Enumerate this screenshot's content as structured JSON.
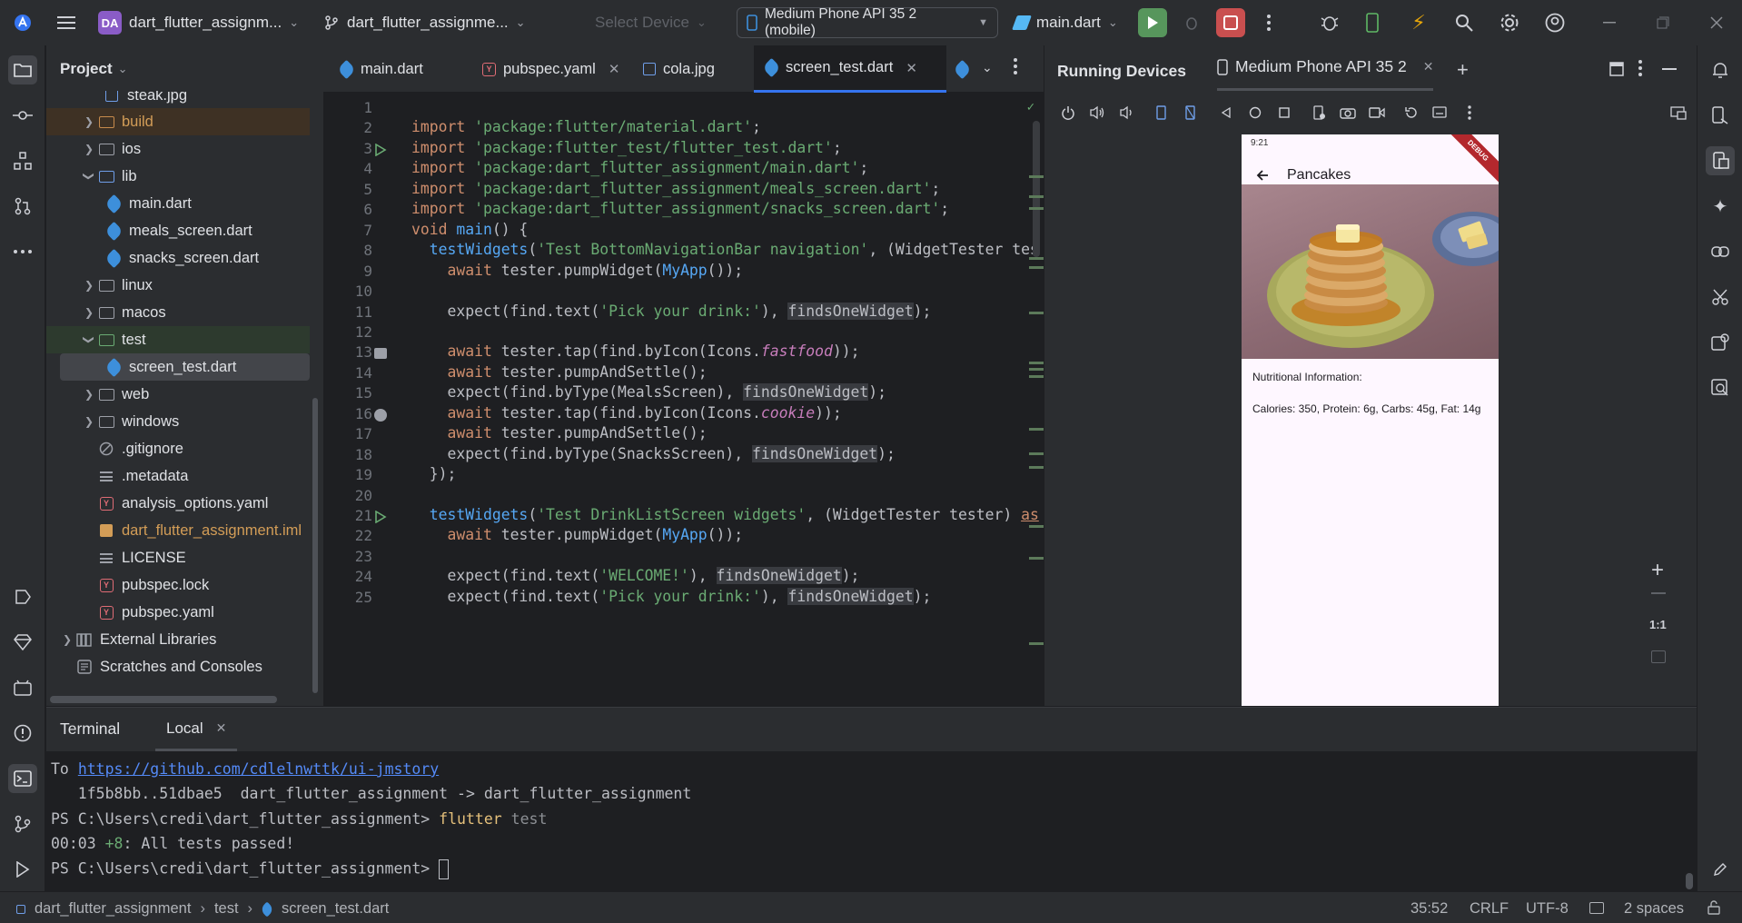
{
  "titlebar": {
    "project_badge": "DA",
    "project_name": "dart_flutter_assignm...",
    "branch": "dart_flutter_assignme...",
    "device_select": "Select Device",
    "running_device": "Medium Phone API 35 2 (mobile)",
    "run_config": "main.dart"
  },
  "project_panel": {
    "title": "Project",
    "items": [
      {
        "label": "steak.jpg",
        "type": "file"
      },
      {
        "label": "build",
        "type": "folder"
      },
      {
        "label": "ios",
        "type": "folder"
      },
      {
        "label": "lib",
        "type": "folder"
      },
      {
        "label": "main.dart",
        "type": "dart"
      },
      {
        "label": "meals_screen.dart",
        "type": "dart"
      },
      {
        "label": "snacks_screen.dart",
        "type": "dart"
      },
      {
        "label": "linux",
        "type": "folder"
      },
      {
        "label": "macos",
        "type": "folder"
      },
      {
        "label": "test",
        "type": "folder"
      },
      {
        "label": "screen_test.dart",
        "type": "dart"
      },
      {
        "label": "web",
        "type": "folder"
      },
      {
        "label": "windows",
        "type": "folder"
      },
      {
        "label": ".gitignore",
        "type": "file"
      },
      {
        "label": ".metadata",
        "type": "file"
      },
      {
        "label": "analysis_options.yaml",
        "type": "yaml"
      },
      {
        "label": "dart_flutter_assignment.iml",
        "type": "file"
      },
      {
        "label": "LICENSE",
        "type": "file"
      },
      {
        "label": "pubspec.lock",
        "type": "yaml"
      },
      {
        "label": "pubspec.yaml",
        "type": "yaml"
      },
      {
        "label": "External Libraries",
        "type": "lib"
      },
      {
        "label": "Scratches and Consoles",
        "type": "scratch"
      }
    ]
  },
  "editor": {
    "tabs": [
      "main.dart",
      "pubspec.yaml",
      "cola.jpg",
      "screen_test.dart"
    ],
    "line_numbers": [
      "1",
      "2",
      "3",
      "4",
      "5",
      "6",
      "7",
      "8",
      "9",
      "10",
      "11",
      "12",
      "13",
      "14",
      "15",
      "16",
      "17",
      "18",
      "19",
      "20",
      "21",
      "22",
      "23",
      "24",
      "25"
    ]
  },
  "devices": {
    "panel_title": "Running Devices",
    "device_tab": "Medium Phone API 35 2",
    "zoom_label": "1:1"
  },
  "phone": {
    "time": "9:21",
    "title": "Pancakes",
    "nutrition_heading": "Nutritional Information:",
    "nutrition_values": "Calories: 350, Protein: 6g, Carbs: 45g, Fat: 14g",
    "debug_banner": "DEBUG"
  },
  "terminal": {
    "tab_title": "Terminal",
    "local_tab": "Local",
    "line1_prefix": "To ",
    "line1_link": "https://github.com/cdlelnwttk/ui-jmstory",
    "line2": "   1f5b8bb..51dbae5  dart_flutter_assignment -> dart_flutter_assignment",
    "prompt": "PS C:\\Users\\credi\\dart_flutter_assignment> ",
    "cmd_flutter": "flutter",
    "cmd_arg": " test",
    "result_time": "00:03 ",
    "result_count": "+8",
    "result_text": ": All tests passed!"
  },
  "statusbar": {
    "crumbs": [
      "dart_flutter_assignment",
      "test",
      "screen_test.dart"
    ],
    "position": "35:52",
    "line_ending": "CRLF",
    "encoding": "UTF-8",
    "indent": "2 spaces"
  }
}
